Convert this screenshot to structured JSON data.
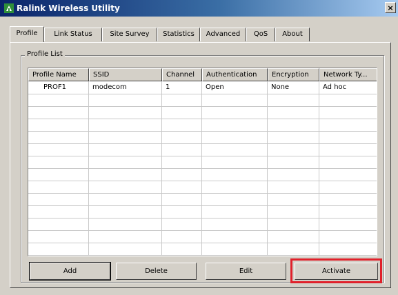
{
  "window": {
    "title": "Ralink Wireless Utility",
    "close_label": "×",
    "title_icon": "ralink-app-icon"
  },
  "tabs": [
    {
      "label": "Profile",
      "active": true
    },
    {
      "label": "Link Status",
      "active": false
    },
    {
      "label": "Site Survey",
      "active": false
    },
    {
      "label": "Statistics",
      "active": false
    },
    {
      "label": "Advanced",
      "active": false
    },
    {
      "label": "QoS",
      "active": false
    },
    {
      "label": "About",
      "active": false
    }
  ],
  "profile_list": {
    "group_label": "Profile List",
    "columns": [
      "Profile Name",
      "SSID",
      "Channel",
      "Authentication",
      "Encryption",
      "Network Ty..."
    ],
    "rows": [
      {
        "profile_name": "PROF1",
        "ssid": "modecom",
        "channel": "1",
        "authentication": "Open",
        "encryption": "None",
        "network_type": "Ad hoc"
      }
    ]
  },
  "buttons": {
    "add": "Add",
    "delete": "Delete",
    "edit": "Edit",
    "activate": "Activate"
  },
  "colors": {
    "highlight_box": "#e0202a",
    "titlebar_start": "#0a246a",
    "titlebar_end": "#a6caf0"
  }
}
